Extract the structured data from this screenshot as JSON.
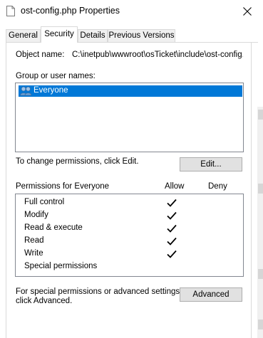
{
  "window": {
    "title": "ost-config.php Properties",
    "icon": "file-icon",
    "close_icon": "close-icon"
  },
  "tabs": [
    {
      "label": "General",
      "active": false
    },
    {
      "label": "Security",
      "active": true
    },
    {
      "label": "Details",
      "active": false
    },
    {
      "label": "Previous Versions",
      "active": false
    }
  ],
  "object": {
    "label": "Object name:",
    "value": "C:\\inetpub\\wwwroot\\osTicket\\include\\ost-config.p"
  },
  "groups": {
    "label": "Group or user names:",
    "items": [
      {
        "name": "Everyone",
        "icon": "users-group-icon",
        "selected": true
      }
    ]
  },
  "change_permissions": {
    "text": "To change permissions, click Edit.",
    "button": "Edit..."
  },
  "permissions": {
    "header": "Permissions for Everyone",
    "allow_label": "Allow",
    "deny_label": "Deny",
    "rows": [
      {
        "name": "Full control",
        "allow": true,
        "deny": false
      },
      {
        "name": "Modify",
        "allow": true,
        "deny": false
      },
      {
        "name": "Read & execute",
        "allow": true,
        "deny": false
      },
      {
        "name": "Read",
        "allow": true,
        "deny": false
      },
      {
        "name": "Write",
        "allow": true,
        "deny": false
      },
      {
        "name": "Special permissions",
        "allow": false,
        "deny": false
      }
    ]
  },
  "advanced": {
    "text_line1": "For special permissions or advanced settings,",
    "text_line2": "click Advanced.",
    "button": "Advanced"
  },
  "colors": {
    "selection": "#0078d7",
    "button_bg": "#e1e1e1",
    "border": "#828790"
  }
}
